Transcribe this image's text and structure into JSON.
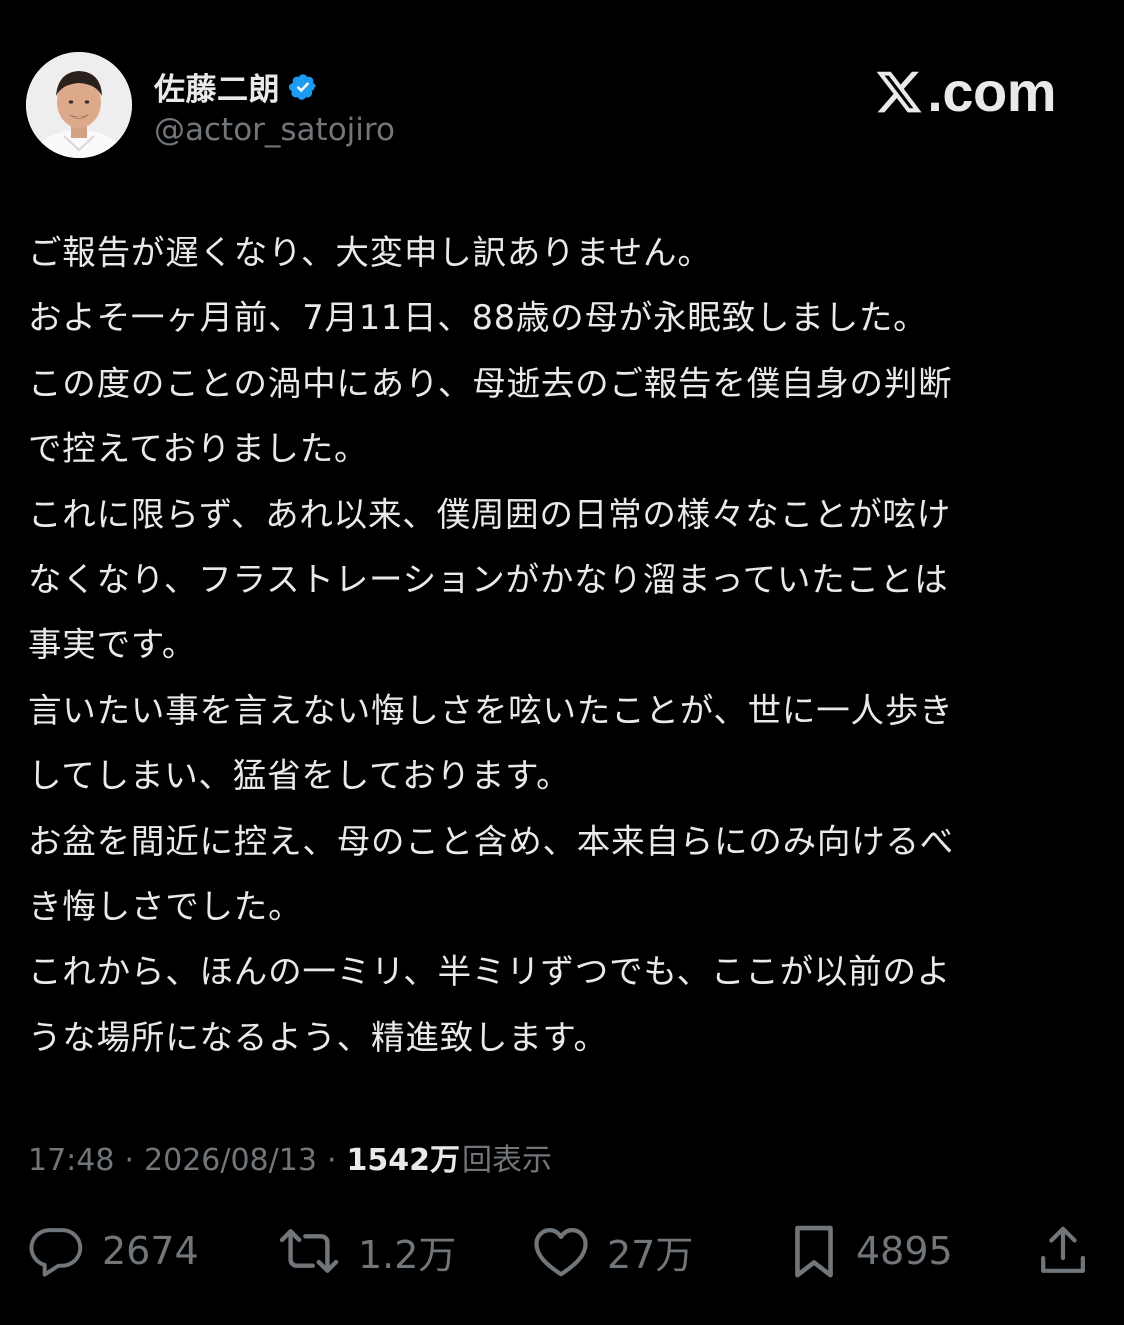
{
  "author": {
    "display_name": "佐藤二朗",
    "handle": "@actor_satojiro",
    "verified_icon": "verified-badge-icon",
    "verified_color": "#1d9bf0"
  },
  "brand": {
    "icon": "x-logo-icon",
    "text": ".com"
  },
  "post": {
    "lines": [
      "ご報告が遅くなり、大変申し訳ありません。",
      "およそ一ヶ月前、7月11日、88歳の母が永眠致しました。",
      "この度のことの渦中にあり、母逝去のご報告を僕自身の判断",
      "で控えておりました。",
      "これに限らず、あれ以来、僕周囲の日常の様々なことが呟け",
      "なくなり、フラストレーションがかなり溜まっていたことは",
      "事実です。",
      "言いたい事を言えない悔しさを呟いたことが、世に一人歩き",
      "してしまい、猛省をしております。",
      "お盆を間近に控え、母のこと含め、本来自らにのみ向けるべ",
      "き悔しさでした。",
      "これから、ほんの一ミリ、半ミリずつでも、ここが以前のよ",
      "うな場所になるよう、精進致します。"
    ]
  },
  "meta": {
    "time": "17:48",
    "separator": "·",
    "date": "2026/08/13",
    "views_count": "1542万",
    "views_label": "回表示"
  },
  "actions": {
    "reply": {
      "icon": "reply-icon",
      "count": "2674"
    },
    "repost": {
      "icon": "repost-icon",
      "count": "1.2万"
    },
    "like": {
      "icon": "heart-icon",
      "count": "27万"
    },
    "bookmark": {
      "icon": "bookmark-icon",
      "count": "4895"
    },
    "share": {
      "icon": "share-icon"
    }
  },
  "colors": {
    "background": "#000000",
    "text": "#e7e9ea",
    "secondary": "#71767b",
    "accent": "#1d9bf0"
  }
}
